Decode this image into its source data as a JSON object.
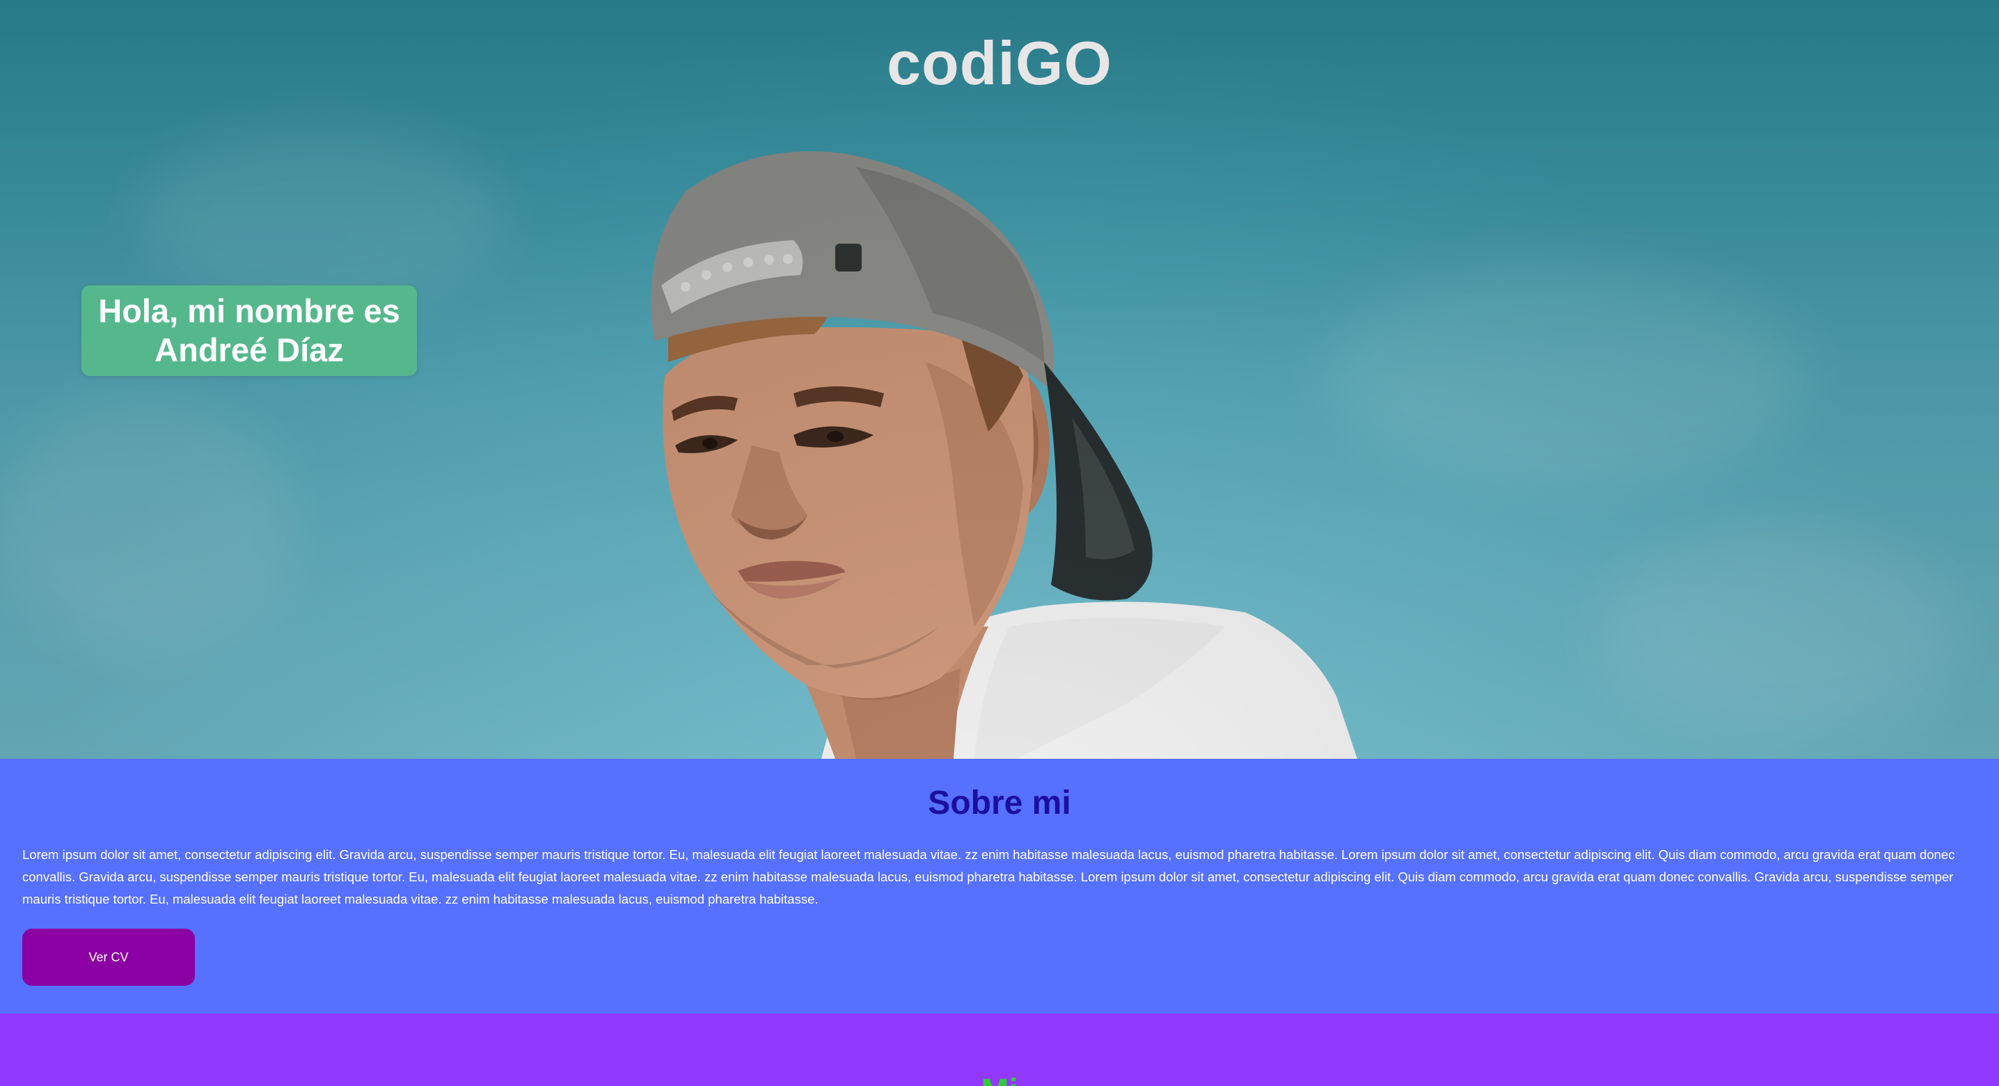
{
  "header": {
    "title": "codiGO"
  },
  "hero": {
    "greeting": "Hola, mi nombre es Andreé Díaz",
    "badge_color": "#55b88d"
  },
  "about": {
    "title": "Sobre mi",
    "text": "Lorem ipsum dolor sit amet, consectetur adipiscing elit. Gravida arcu, suspendisse semper mauris tristique tortor. Eu, malesuada elit feugiat laoreet malesuada vitae. zz enim habitasse malesuada lacus, euismod pharetra habitasse. Lorem ipsum dolor sit amet, consectetur adipiscing elit. Quis diam commodo, arcu gravida erat quam donec convallis. Gravida arcu, suspendisse semper mauris tristique tortor. Eu, malesuada elit feugiat laoreet malesuada vitae. zz enim habitasse malesuada lacus, euismod pharetra habitasse. Lorem ipsum dolor sit amet, consectetur adipiscing elit. Quis diam commodo, arcu gravida erat quam donec convallis. Gravida arcu, suspendisse semper mauris tristique tortor. Eu, malesuada elit feugiat laoreet malesuada vitae. zz enim habitasse malesuada lacus, euismod pharetra habitasse.",
    "cv_button_label": "Ver CV",
    "background_color": "#5670ff",
    "title_color": "#1b0f9f",
    "button_color": "#8b00a3"
  },
  "next_section": {
    "title_partial": "Mi",
    "background_color": "#9139ff",
    "title_color": "#33cc33"
  }
}
